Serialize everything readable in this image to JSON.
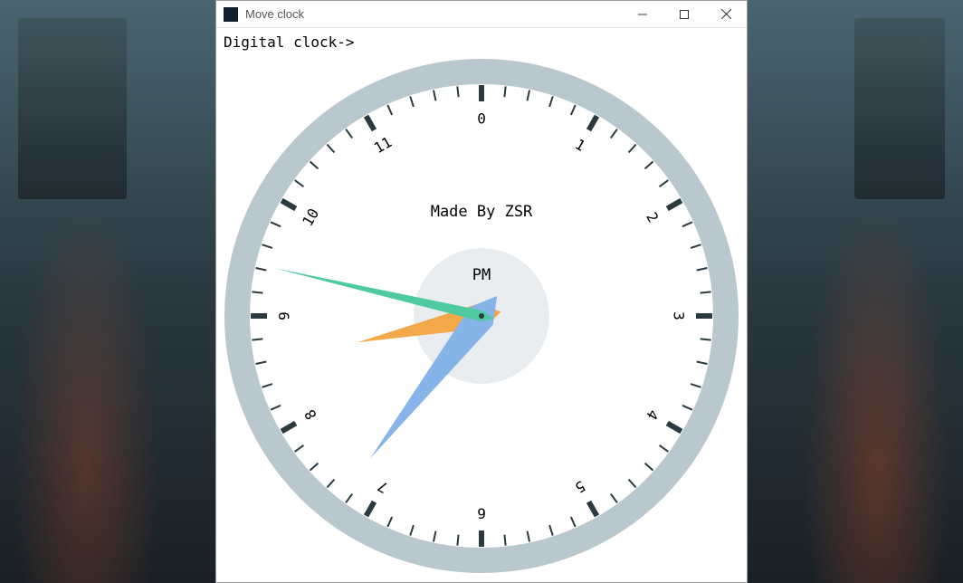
{
  "window": {
    "title": "Move clock",
    "minimize_label": "Minimize",
    "maximize_label": "Maximize",
    "close_label": "Close"
  },
  "labels": {
    "digital": "Digital clock->",
    "credit": "Made  By  ZSR",
    "ampm": "PM"
  },
  "clock": {
    "hours": [
      "0",
      "1",
      "2",
      "3",
      "4",
      "5",
      "6",
      "7",
      "8",
      "9",
      "10",
      "11"
    ],
    "hour_hand_angle": 258,
    "minute_hand_angle": 218,
    "second_hand_angle": 283,
    "colors": {
      "outer_ring": "#b9c7ce",
      "tick": "#2a3a3f",
      "inner_circle": "#e9edef",
      "hour_hand": "#f3a84a",
      "minute_hand": "#86b4e8",
      "second_hand": "#4fc9a0",
      "center_dot": "#2a3a3f"
    }
  }
}
